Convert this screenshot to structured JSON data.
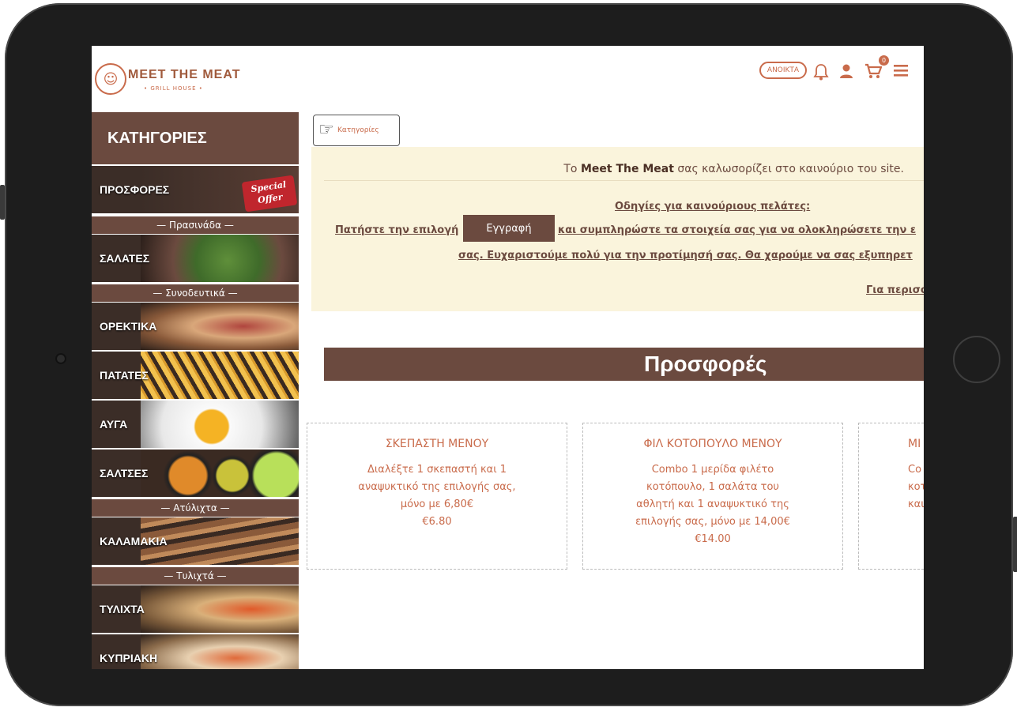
{
  "header": {
    "brand": "MEET THE MEAT",
    "brand_sub": "• GRILL HOUSE •",
    "status_badge": "ΑΝΟΙΚΤΑ",
    "cart_count": "0"
  },
  "sidebar": {
    "title": "ΚΑΤΗΓΟΡΙΕΣ",
    "offers": {
      "label": "ΠΡΟΣΦΟΡΕΣ",
      "badge_line1": "Special",
      "badge_line2": "Offer"
    },
    "sections": [
      {
        "label": "— Πρασινάδα —"
      },
      {
        "label": "— Συνοδευτικά —"
      },
      {
        "label": "— Ατύλιχτα —"
      },
      {
        "label": "— Τυλιχτά —"
      }
    ],
    "items": [
      {
        "label": "ΣΑΛΑΤΕΣ"
      },
      {
        "label": "ΟΡΕΚΤΙΚΑ"
      },
      {
        "label": "ΠΑΤΑΤΕΣ"
      },
      {
        "label": "ΑΥΓΑ"
      },
      {
        "label": "ΣΑΛΤΣΕΣ"
      },
      {
        "label": "ΚΑΛΑΜΑΚΙΑ"
      },
      {
        "label": "ΤΥΛΙΧΤΑ"
      },
      {
        "label": "ΚΥΠΡΙΑΚΗ"
      }
    ]
  },
  "main": {
    "categories_button": "Κατηγορίες",
    "welcome_prefix": "Το ",
    "welcome_brand": "Meet The Meat",
    "welcome_suffix": " σας καλωσορίζει στο καινούριο του site.",
    "instructions_title": "Οδηγίες για καινούριους πελάτες:",
    "instructions_part1": "Πατήστε την επιλογή",
    "register_button": "Εγγραφή",
    "instructions_part2": "και συμπληρώστε τα στοιχεία σας για να ολοκληρώσετε την ε",
    "instructions_part3": "σας. Ευχαριστούμε πολύ για την προτίμησή σας. Θα χαρούμε να σας εξυπηρετ",
    "more_link": "Για περισσ",
    "offers_title": "Προσφορές",
    "cards": [
      {
        "title": "ΣΚΕΠΑΣΤΗ ΜΕΝΟΥ",
        "desc": "Διαλέξτε 1 σκεπαστή και 1 αναψυκτικό της επιλογής σας, μόνο με 6,80€",
        "price": "€6.80"
      },
      {
        "title": "ΦΙΛ ΚΟΤΟΠΟΥΛΟ ΜΕΝΟΥ",
        "desc": "Combo 1 μερίδα φιλέτο κοτόπουλο, 1 σαλάτα του αθλητή και 1 αναψυκτικό της επιλογής σας, μόνο με 14,00€",
        "price": "€14.00"
      },
      {
        "title": "ΜΙ",
        "desc": "Co κοτόπ και",
        "price": ""
      }
    ]
  },
  "colors": {
    "brand_brown": "#6b4a3f",
    "accent": "#c96b4b",
    "notice_bg": "#faf4dc"
  }
}
